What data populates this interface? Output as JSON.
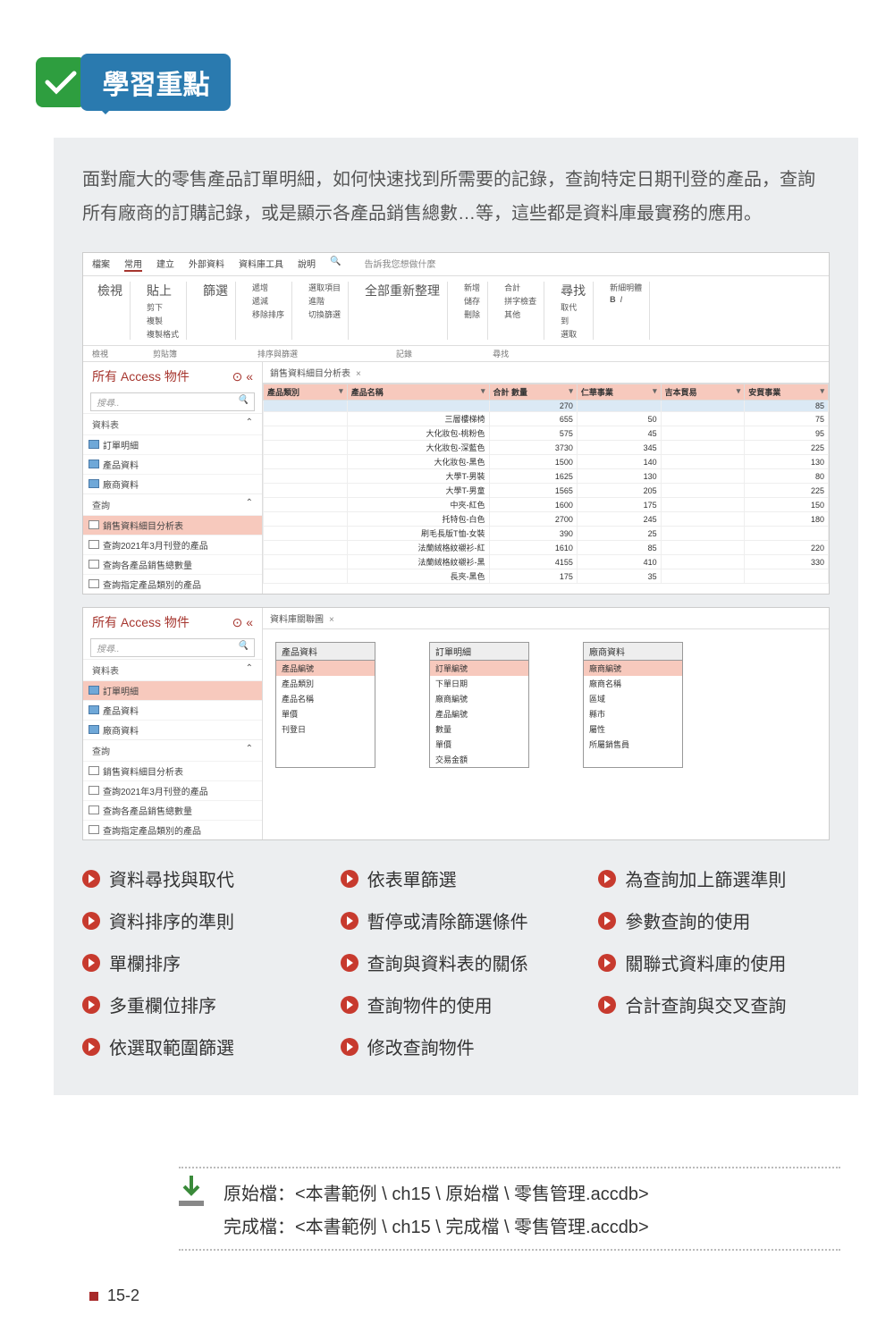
{
  "badge_title": "學習重點",
  "intro": "面對龐大的零售產品訂單明細，如何快速找到所需要的記錄，查詢特定日期刊登的產品，查詢所有廠商的訂購記錄，或是顯示各產品銷售總數…等，這些都是資料庫最實務的應用。",
  "ribbon": {
    "tabs": [
      "檔案",
      "常用",
      "建立",
      "外部資料",
      "資料庫工具",
      "說明"
    ],
    "tell": "告訴我您想做什麼",
    "groups": [
      "檢視",
      "剪貼簿",
      "排序與篩選",
      "記錄",
      "尋找"
    ],
    "items": {
      "view": "檢視",
      "paste": "貼上",
      "cut": "剪下",
      "copy": "複製",
      "format": "複製格式",
      "filter": "篩選",
      "asc": "遞增",
      "desc": "遞減",
      "clear": "移除排序",
      "sel": "選取項目",
      "adv": "進階",
      "toggle": "切換篩選",
      "all": "全部重新整理",
      "new": "新增",
      "save": "儲存",
      "del": "刪除",
      "sum": "合計",
      "spell": "拼字檢查",
      "more": "其他",
      "find": "尋找",
      "replace": "取代",
      "goto": "到",
      "select": "選取",
      "newrec": "新細明體",
      "B": "B",
      "I": "I"
    }
  },
  "nav": {
    "title": "所有 Access 物件",
    "search": "搜尋..",
    "sec1": "資料表",
    "sec2": "查詢",
    "tables": [
      "訂單明細",
      "產品資料",
      "廠商資料"
    ],
    "queries": [
      "銷售資料細目分析表",
      "查詢2021年3月刊登的產品",
      "查詢各產品銷售總數量",
      "查詢指定產品類別的產品"
    ]
  },
  "tab1": "銷售資料細目分析表",
  "cols": [
    "產品類別",
    "產品名稱",
    "合計 數量",
    "仁華事業",
    "吉本貿易",
    "安貿事業"
  ],
  "rows": [
    [
      "",
      "",
      "270",
      "",
      "",
      "85"
    ],
    [
      "",
      "三層樓梯椅",
      "655",
      "50",
      "",
      "75"
    ],
    [
      "",
      "大化妝包-桃粉色",
      "575",
      "45",
      "",
      "95"
    ],
    [
      "",
      "大化妝包-深藍色",
      "3730",
      "345",
      "",
      "225"
    ],
    [
      "",
      "大化妝包-黑色",
      "1500",
      "140",
      "",
      "130"
    ],
    [
      "",
      "大學T-男裝",
      "1625",
      "130",
      "",
      "80"
    ],
    [
      "",
      "大學T-男童",
      "1565",
      "205",
      "",
      "225"
    ],
    [
      "",
      "中夾-紅色",
      "1600",
      "175",
      "",
      "150"
    ],
    [
      "",
      "托特包-白色",
      "2700",
      "245",
      "",
      "180"
    ],
    [
      "",
      "刷毛長版T恤-女裝",
      "390",
      "25",
      "",
      ""
    ],
    [
      "",
      "法蘭絨格紋襯衫-紅",
      "1610",
      "85",
      "",
      "220"
    ],
    [
      "",
      "法蘭絨格紋襯衫-黑",
      "4155",
      "410",
      "",
      "330"
    ],
    [
      "",
      "長夾-黑色",
      "175",
      "35",
      "",
      ""
    ]
  ],
  "tab2": "資料庫關聯圖",
  "nav2": {
    "tables": [
      "訂單明細",
      "產品資料",
      "廠商資料"
    ],
    "queries": [
      "銷售資料細目分析表",
      "查詢2021年3月刊登的產品",
      "查詢各產品銷售總數量",
      "查詢指定產品類別的產品"
    ]
  },
  "rel": {
    "b1": {
      "title": "產品資料",
      "key": "產品編號",
      "f": [
        "產品類別",
        "產品名稱",
        "單價",
        "刊登日"
      ]
    },
    "b2": {
      "title": "訂單明細",
      "key": "訂單編號",
      "f": [
        "下單日期",
        "廠商編號",
        "產品編號",
        "數量",
        "單價",
        "交易金額"
      ]
    },
    "b3": {
      "title": "廠商資料",
      "key": "廠商編號",
      "f": [
        "廠商名稱",
        "區域",
        "縣市",
        "屬性",
        "所屬銷售員"
      ]
    }
  },
  "bullets": [
    "資料尋找與取代",
    "依表單篩選",
    "為查詢加上篩選準則",
    "資料排序的準則",
    "暫停或清除篩選條件",
    "參數查詢的使用",
    "單欄排序",
    "查詢與資料表的關係",
    "關聯式資料庫的使用",
    "多重欄位排序",
    "查詢物件的使用",
    "合計查詢與交叉查詢",
    "依選取範圍篩選",
    "修改查詢物件"
  ],
  "files": {
    "src": "原始檔：<本書範例 \\ ch15 \\ 原始檔 \\ 零售管理.accdb>",
    "dst": "完成檔：<本書範例 \\ ch15 \\ 完成檔 \\ 零售管理.accdb>"
  },
  "pagenum": "15-2"
}
